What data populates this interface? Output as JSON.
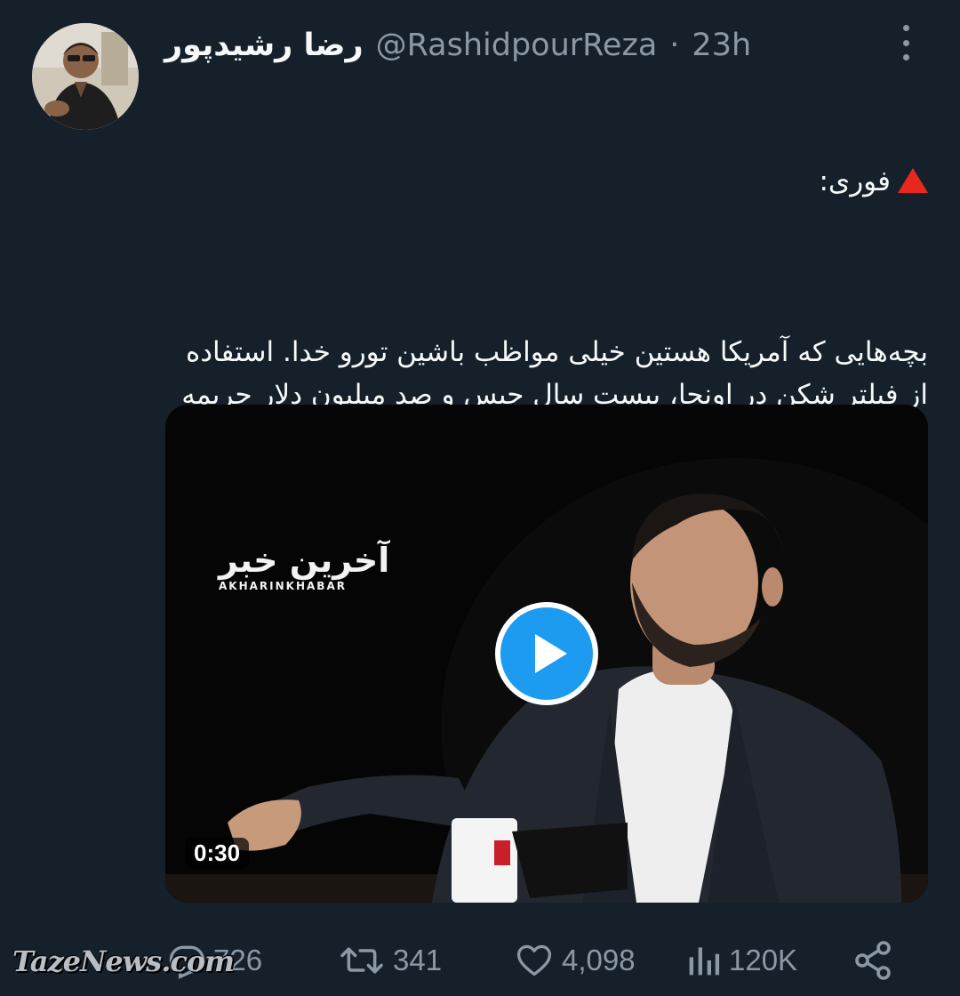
{
  "author": {
    "display_name": "رضا رشیدپور",
    "handle": "@RashidpourReza",
    "separator": "·",
    "time": "23h"
  },
  "tweet": {
    "tag_icon": "red-triangle-icon",
    "tag_text": "فوری:",
    "body": "بچه‌هایی که آمریکا هستین خیلی مواظب باشین تورو خدا. استفاده از فیلتر شکن در اونجا، بیست سال حبس و صد میلیون دلار جریمه داره.\nمنم الان فهمیدم، وگرنه زودتر بهتون می‌گفتم."
  },
  "video": {
    "logo_fa": "آخرین خبر",
    "logo_en": "AKHARINKHABAR",
    "duration": "0:30"
  },
  "actions": {
    "replies": "726",
    "retweets": "341",
    "likes": "4,098",
    "views": "120K"
  },
  "watermark": "TazeNews.com",
  "colors": {
    "background": "#15202b",
    "text_primary": "#f7f9f9",
    "text_secondary": "#8b98a5",
    "accent": "#1d9bf0",
    "alert": "#e8281e"
  }
}
